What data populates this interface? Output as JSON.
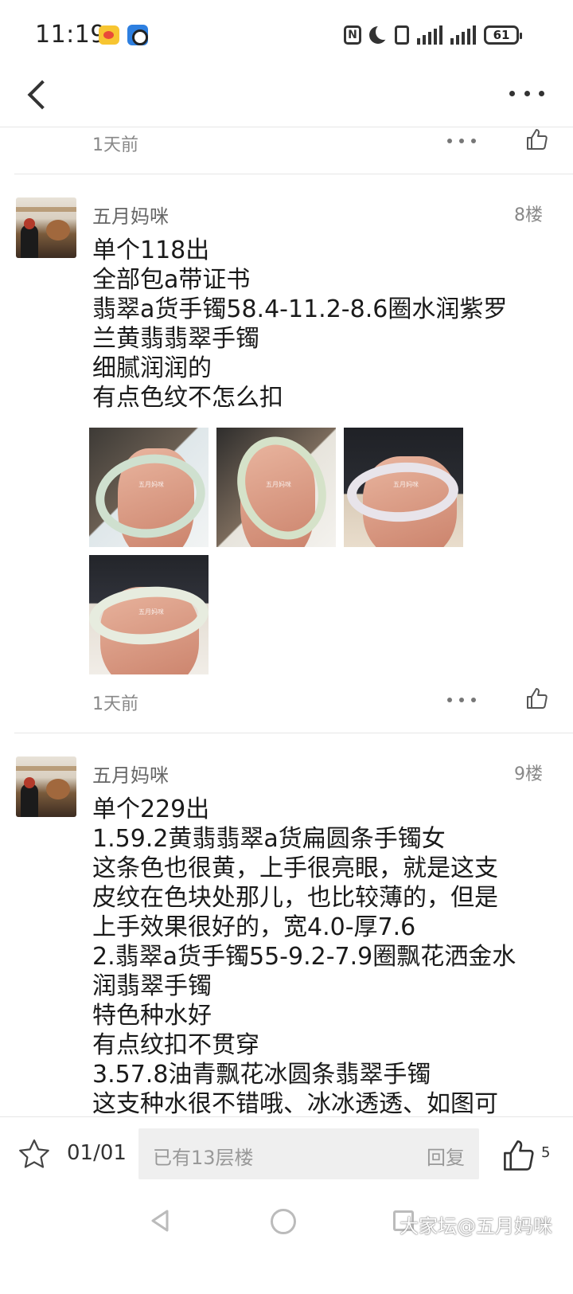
{
  "status_bar": {
    "time": "11:19",
    "battery": "61"
  },
  "posts": [
    {
      "time": "1天前"
    },
    {
      "username": "五月妈咪",
      "floor": "8楼",
      "lines": [
        "单个118出",
        "全部包a带证书",
        "翡翠a货手镯58.4-11.2-8.6圈水润紫罗",
        "兰黄翡翡翠手镯",
        "细腻润润的",
        "有点色纹不怎么扣"
      ],
      "image_count": 4,
      "time": "1天前"
    },
    {
      "username": "五月妈咪",
      "floor": "9楼",
      "lines": [
        "单个229出",
        "1.59.2黄翡翡翠a货扁圆条手镯女",
        "这条色也很黄，上手很亮眼，就是这支",
        "皮纹在色块处那儿，也比较薄的，但是",
        "上手效果很好的，宽4.0-厚7.6",
        "2.翡翠a货手镯55-9.2-7.9圈飘花洒金水",
        "润翡翠手镯",
        "特色种水好",
        "有点纹扣不贯穿",
        "3.57.8油青飘花冰圆条翡翠手镯",
        "这支种水很不错哦、冰冰透透、如图可"
      ]
    }
  ],
  "bottom_bar": {
    "page_indicator": "01/01",
    "reply_placeholder": "已有13层楼",
    "reply_button": "回复",
    "like_count": "5"
  },
  "watermark": "大家坛@五月妈咪",
  "colors": {
    "text_primary": "#1a1a1a",
    "text_secondary": "#888888",
    "divider": "#e6e6e6",
    "reply_box": "#efefef"
  }
}
